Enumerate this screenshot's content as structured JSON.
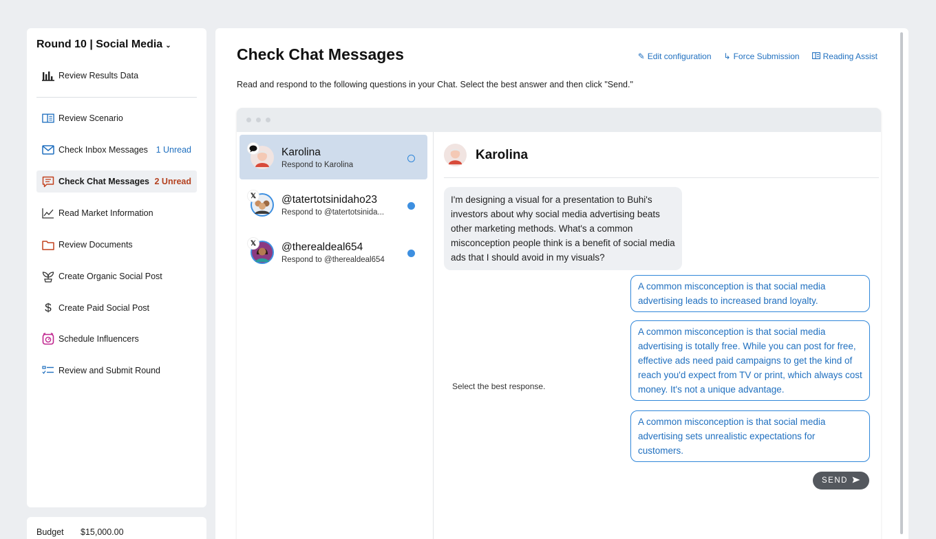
{
  "sidebar": {
    "round_title": "Round 10 | Social Media",
    "items": [
      {
        "label": "Review Results Data",
        "icon": "bar-chart-icon"
      },
      {
        "label": "Review Scenario",
        "icon": "book-icon"
      },
      {
        "label": "Check Inbox Messages",
        "icon": "envelope-icon",
        "badge": "1 Unread"
      },
      {
        "label": "Check Chat Messages",
        "icon": "chat-icon",
        "badge": "2 Unread"
      },
      {
        "label": "Read Market Information",
        "icon": "line-chart-icon"
      },
      {
        "label": "Review Documents",
        "icon": "folder-icon"
      },
      {
        "label": "Create Organic Social Post",
        "icon": "sprout-icon"
      },
      {
        "label": "Create Paid Social Post",
        "icon": "dollar-icon"
      },
      {
        "label": "Schedule Influencers",
        "icon": "alarm-clock-icon"
      },
      {
        "label": "Review and Submit Round",
        "icon": "checklist-icon"
      }
    ]
  },
  "budget": {
    "label": "Budget",
    "value": "$15,000.00"
  },
  "main": {
    "title": "Check Chat Messages",
    "actions": {
      "edit": "Edit configuration",
      "force": "Force Submission",
      "reading": "Reading Assist"
    },
    "instructions": "Read and respond to the following questions in your Chat. Select the best answer and then click \"Send.\""
  },
  "conversations": [
    {
      "name": "Karolina",
      "sub": "Respond to Karolina",
      "platform": "chat"
    },
    {
      "name": "@tatertotsinidaho23",
      "sub": "Respond to @tatertotsinida...",
      "platform": "X"
    },
    {
      "name": "@therealdeal654",
      "sub": "Respond to @therealdeal654",
      "platform": "X"
    }
  ],
  "chat": {
    "contact": "Karolina",
    "incoming": "I'm designing a visual for a presentation to Buhi's investors about why social media advertising beats other marketing methods. What's a common misconception people think is a benefit of social media ads that I should avoid in my visuals?",
    "prompt": "Select the best response.",
    "options": [
      "A common misconception is that social media advertising leads to increased brand loyalty.",
      "A common misconception is that social media advertising is totally free. While you can post for free, effective ads need paid campaigns to get the kind of reach you'd expect from TV or print, which always cost money. It's not a unique advantage.",
      "A common misconception is that social media advertising sets unrealistic expectations for customers."
    ],
    "send_label": "SEND"
  },
  "colors": {
    "accent": "#1f6fbf",
    "alert": "#b4411f",
    "selected_conv": "#cfdcec",
    "unread_dot": "#3d8fe0"
  }
}
